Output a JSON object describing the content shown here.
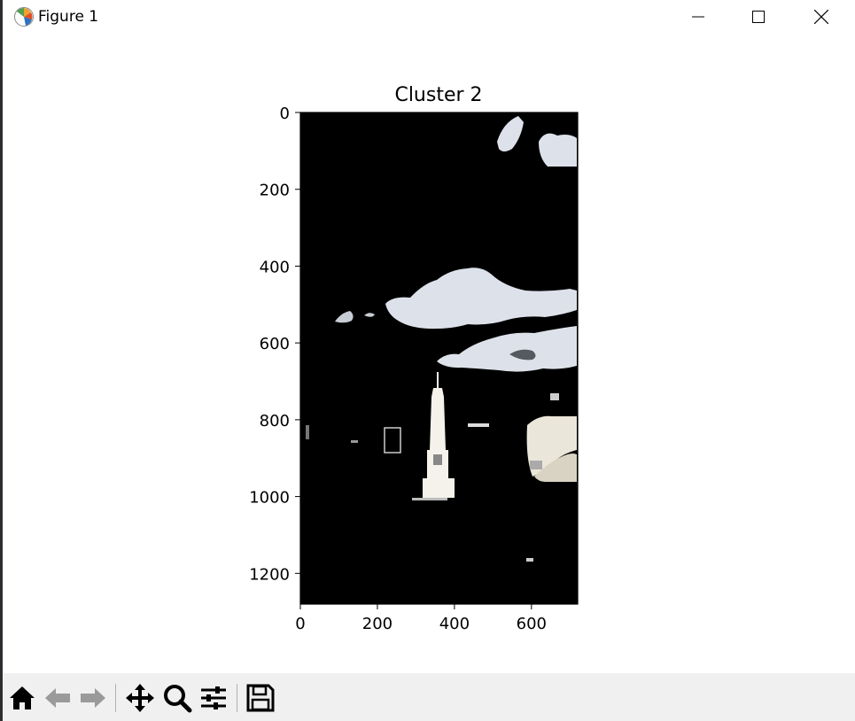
{
  "window": {
    "title": "Figure 1",
    "icon": "matplotlib-logo-icon"
  },
  "window_controls": [
    "minimize-icon",
    "maximize-icon",
    "close-icon"
  ],
  "figure": {
    "title": "Cluster 2",
    "image_content": "segmented photo: white clouds and monument on black background"
  },
  "chart_data": {
    "type": "image",
    "title": "Cluster 2",
    "xlabel": "",
    "ylabel": "",
    "xlim": [
      0,
      720
    ],
    "ylim": [
      1280,
      0
    ],
    "x_ticks": [
      "0",
      "200",
      "400",
      "600"
    ],
    "y_ticks": [
      "0",
      "200",
      "400",
      "600",
      "800",
      "1000",
      "1200"
    ],
    "x_tick_values": [
      0,
      200,
      400,
      600
    ],
    "y_tick_values": [
      0,
      200,
      400,
      600,
      800,
      1000,
      1200
    ]
  },
  "toolbar": {
    "buttons": [
      "home-icon",
      "back-icon",
      "forward-icon",
      "pan-icon",
      "zoom-icon",
      "configure-subplots-icon",
      "save-icon"
    ]
  },
  "colors": {
    "background": "#ffffff",
    "toolbar": "#f0f0f0",
    "image_background": "#000000",
    "cloud": "#dde2ea"
  }
}
